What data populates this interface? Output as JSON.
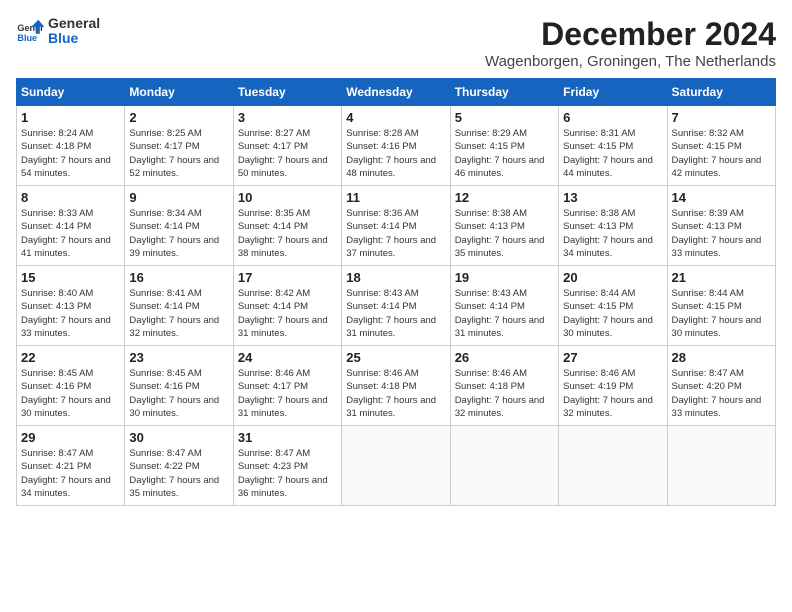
{
  "logo": {
    "line1": "General",
    "line2": "Blue"
  },
  "title": "December 2024",
  "location": "Wagenborgen, Groningen, The Netherlands",
  "days_of_week": [
    "Sunday",
    "Monday",
    "Tuesday",
    "Wednesday",
    "Thursday",
    "Friday",
    "Saturday"
  ],
  "weeks": [
    [
      {
        "day": "1",
        "sunrise": "Sunrise: 8:24 AM",
        "sunset": "Sunset: 4:18 PM",
        "daylight": "Daylight: 7 hours and 54 minutes."
      },
      {
        "day": "2",
        "sunrise": "Sunrise: 8:25 AM",
        "sunset": "Sunset: 4:17 PM",
        "daylight": "Daylight: 7 hours and 52 minutes."
      },
      {
        "day": "3",
        "sunrise": "Sunrise: 8:27 AM",
        "sunset": "Sunset: 4:17 PM",
        "daylight": "Daylight: 7 hours and 50 minutes."
      },
      {
        "day": "4",
        "sunrise": "Sunrise: 8:28 AM",
        "sunset": "Sunset: 4:16 PM",
        "daylight": "Daylight: 7 hours and 48 minutes."
      },
      {
        "day": "5",
        "sunrise": "Sunrise: 8:29 AM",
        "sunset": "Sunset: 4:15 PM",
        "daylight": "Daylight: 7 hours and 46 minutes."
      },
      {
        "day": "6",
        "sunrise": "Sunrise: 8:31 AM",
        "sunset": "Sunset: 4:15 PM",
        "daylight": "Daylight: 7 hours and 44 minutes."
      },
      {
        "day": "7",
        "sunrise": "Sunrise: 8:32 AM",
        "sunset": "Sunset: 4:15 PM",
        "daylight": "Daylight: 7 hours and 42 minutes."
      }
    ],
    [
      {
        "day": "8",
        "sunrise": "Sunrise: 8:33 AM",
        "sunset": "Sunset: 4:14 PM",
        "daylight": "Daylight: 7 hours and 41 minutes."
      },
      {
        "day": "9",
        "sunrise": "Sunrise: 8:34 AM",
        "sunset": "Sunset: 4:14 PM",
        "daylight": "Daylight: 7 hours and 39 minutes."
      },
      {
        "day": "10",
        "sunrise": "Sunrise: 8:35 AM",
        "sunset": "Sunset: 4:14 PM",
        "daylight": "Daylight: 7 hours and 38 minutes."
      },
      {
        "day": "11",
        "sunrise": "Sunrise: 8:36 AM",
        "sunset": "Sunset: 4:14 PM",
        "daylight": "Daylight: 7 hours and 37 minutes."
      },
      {
        "day": "12",
        "sunrise": "Sunrise: 8:38 AM",
        "sunset": "Sunset: 4:13 PM",
        "daylight": "Daylight: 7 hours and 35 minutes."
      },
      {
        "day": "13",
        "sunrise": "Sunrise: 8:38 AM",
        "sunset": "Sunset: 4:13 PM",
        "daylight": "Daylight: 7 hours and 34 minutes."
      },
      {
        "day": "14",
        "sunrise": "Sunrise: 8:39 AM",
        "sunset": "Sunset: 4:13 PM",
        "daylight": "Daylight: 7 hours and 33 minutes."
      }
    ],
    [
      {
        "day": "15",
        "sunrise": "Sunrise: 8:40 AM",
        "sunset": "Sunset: 4:13 PM",
        "daylight": "Daylight: 7 hours and 33 minutes."
      },
      {
        "day": "16",
        "sunrise": "Sunrise: 8:41 AM",
        "sunset": "Sunset: 4:14 PM",
        "daylight": "Daylight: 7 hours and 32 minutes."
      },
      {
        "day": "17",
        "sunrise": "Sunrise: 8:42 AM",
        "sunset": "Sunset: 4:14 PM",
        "daylight": "Daylight: 7 hours and 31 minutes."
      },
      {
        "day": "18",
        "sunrise": "Sunrise: 8:43 AM",
        "sunset": "Sunset: 4:14 PM",
        "daylight": "Daylight: 7 hours and 31 minutes."
      },
      {
        "day": "19",
        "sunrise": "Sunrise: 8:43 AM",
        "sunset": "Sunset: 4:14 PM",
        "daylight": "Daylight: 7 hours and 31 minutes."
      },
      {
        "day": "20",
        "sunrise": "Sunrise: 8:44 AM",
        "sunset": "Sunset: 4:15 PM",
        "daylight": "Daylight: 7 hours and 30 minutes."
      },
      {
        "day": "21",
        "sunrise": "Sunrise: 8:44 AM",
        "sunset": "Sunset: 4:15 PM",
        "daylight": "Daylight: 7 hours and 30 minutes."
      }
    ],
    [
      {
        "day": "22",
        "sunrise": "Sunrise: 8:45 AM",
        "sunset": "Sunset: 4:16 PM",
        "daylight": "Daylight: 7 hours and 30 minutes."
      },
      {
        "day": "23",
        "sunrise": "Sunrise: 8:45 AM",
        "sunset": "Sunset: 4:16 PM",
        "daylight": "Daylight: 7 hours and 30 minutes."
      },
      {
        "day": "24",
        "sunrise": "Sunrise: 8:46 AM",
        "sunset": "Sunset: 4:17 PM",
        "daylight": "Daylight: 7 hours and 31 minutes."
      },
      {
        "day": "25",
        "sunrise": "Sunrise: 8:46 AM",
        "sunset": "Sunset: 4:18 PM",
        "daylight": "Daylight: 7 hours and 31 minutes."
      },
      {
        "day": "26",
        "sunrise": "Sunrise: 8:46 AM",
        "sunset": "Sunset: 4:18 PM",
        "daylight": "Daylight: 7 hours and 32 minutes."
      },
      {
        "day": "27",
        "sunrise": "Sunrise: 8:46 AM",
        "sunset": "Sunset: 4:19 PM",
        "daylight": "Daylight: 7 hours and 32 minutes."
      },
      {
        "day": "28",
        "sunrise": "Sunrise: 8:47 AM",
        "sunset": "Sunset: 4:20 PM",
        "daylight": "Daylight: 7 hours and 33 minutes."
      }
    ],
    [
      {
        "day": "29",
        "sunrise": "Sunrise: 8:47 AM",
        "sunset": "Sunset: 4:21 PM",
        "daylight": "Daylight: 7 hours and 34 minutes."
      },
      {
        "day": "30",
        "sunrise": "Sunrise: 8:47 AM",
        "sunset": "Sunset: 4:22 PM",
        "daylight": "Daylight: 7 hours and 35 minutes."
      },
      {
        "day": "31",
        "sunrise": "Sunrise: 8:47 AM",
        "sunset": "Sunset: 4:23 PM",
        "daylight": "Daylight: 7 hours and 36 minutes."
      },
      null,
      null,
      null,
      null
    ]
  ]
}
